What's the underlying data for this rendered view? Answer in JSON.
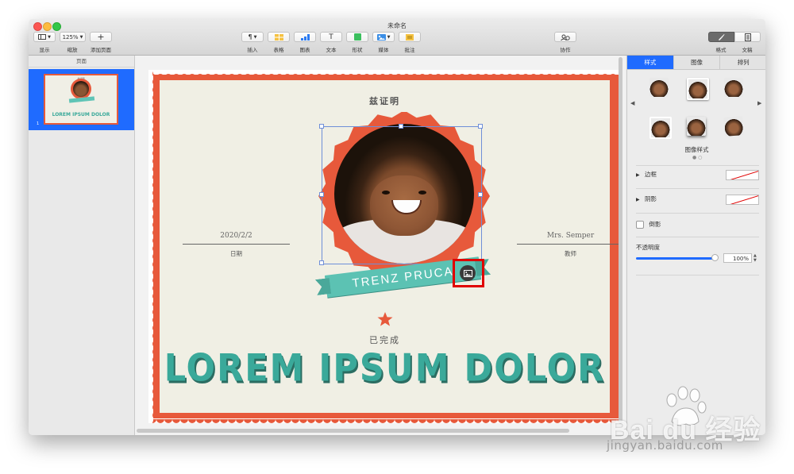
{
  "window": {
    "title": "未命名"
  },
  "toolbar": {
    "view_label": "显示",
    "zoom_value": "125%",
    "zoom_label": "缩放",
    "add_page_label": "添加页面",
    "insert_label": "插入",
    "table_label": "表格",
    "chart_label": "图表",
    "text_label": "文本",
    "shape_label": "形状",
    "media_label": "媒体",
    "comment_label": "批注",
    "collab_label": "协作",
    "format_label": "格式",
    "document_label": "文稿"
  },
  "sidebar": {
    "header": "页面",
    "page_number": "1"
  },
  "certificate": {
    "title": "兹证明",
    "date_value": "2020/2/2",
    "date_label": "日期",
    "teacher_value": "Mrs. Semper",
    "teacher_label": "教师",
    "ribbon_text": "TRENZ PRUCA",
    "completed_label": "已完成",
    "headline": "LOREM IPSUM DOLOR"
  },
  "thumbnail": {
    "title": "兹证明",
    "headline": "LOREM IPSUM DOLOR"
  },
  "inspector": {
    "tabs": [
      "样式",
      "图像",
      "排列"
    ],
    "active_tab": "样式",
    "image_styles_caption": "图像样式",
    "border_label": "边框",
    "shadow_label": "阴影",
    "reflection_label": "倒影",
    "opacity_label": "不透明度",
    "opacity_value": "100%"
  },
  "colors": {
    "accent": "#1f6bff",
    "border_red": "#e7593b",
    "teal": "#3aa99a",
    "highlight": "#e00000"
  },
  "watermark": {
    "brand": "Bai du 经验",
    "url": "jingyan.baidu.com"
  }
}
